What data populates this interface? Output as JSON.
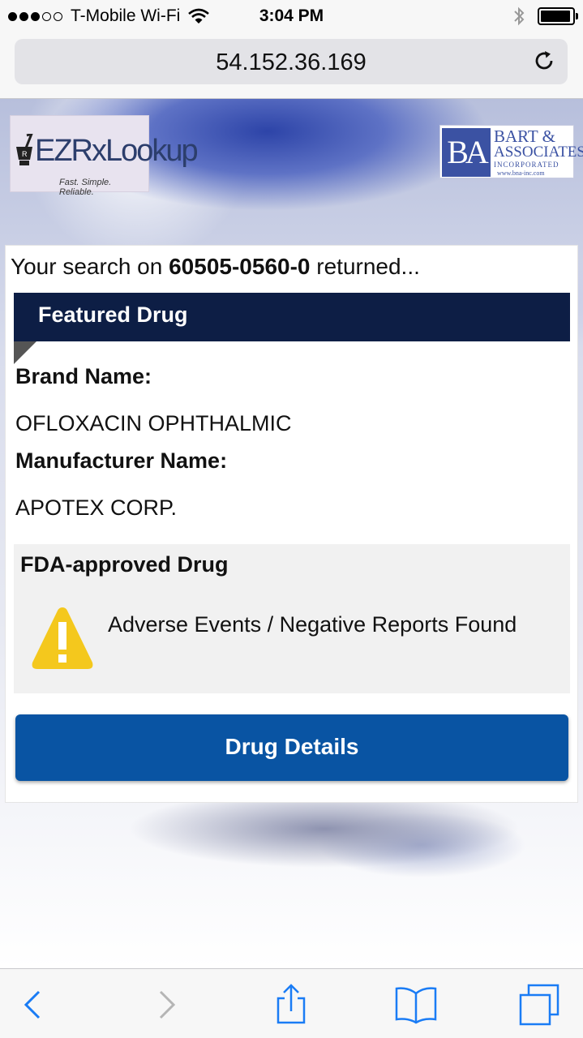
{
  "status_bar": {
    "carrier": "T-Mobile Wi-Fi",
    "time": "3:04 PM",
    "signal_bars_filled": 3,
    "signal_bars_total": 5
  },
  "browser": {
    "url": "54.152.36.169"
  },
  "logos": {
    "ez": {
      "name": "EZRxLookup",
      "tagline": "Fast. Simple. Reliable."
    },
    "ba": {
      "monogram": "BA",
      "line1": "BART &",
      "line2": "ASSOCIATES",
      "line3": "INCORPORATED",
      "line4": "www.bna-inc.com"
    }
  },
  "search": {
    "prefix": "Your search on",
    "ndc": "60505-0560-0",
    "suffix": "returned..."
  },
  "featured": {
    "heading": "Featured Drug",
    "brand_label": "Brand Name:",
    "brand_value": "OFLOXACIN OPHTHALMIC",
    "manufacturer_label": "Manufacturer Name:",
    "manufacturer_value": "APOTEX CORP."
  },
  "fda": {
    "title": "FDA-approved Drug",
    "warning": "Adverse Events / Negative Reports Found"
  },
  "actions": {
    "drug_details": "Drug Details"
  },
  "colors": {
    "band": "#0d1e45",
    "button": "#0954a3",
    "ios_blue": "#1a7cf5",
    "warning_yellow": "#f4c81d"
  },
  "icons": {
    "wifi": "wifi-icon",
    "bluetooth": "bluetooth-icon",
    "battery": "battery-icon",
    "reload": "reload-icon",
    "back": "back-icon",
    "forward": "forward-icon",
    "share": "share-icon",
    "bookmarks": "bookmarks-icon",
    "tabs": "tabs-icon",
    "warning": "warning-icon"
  }
}
